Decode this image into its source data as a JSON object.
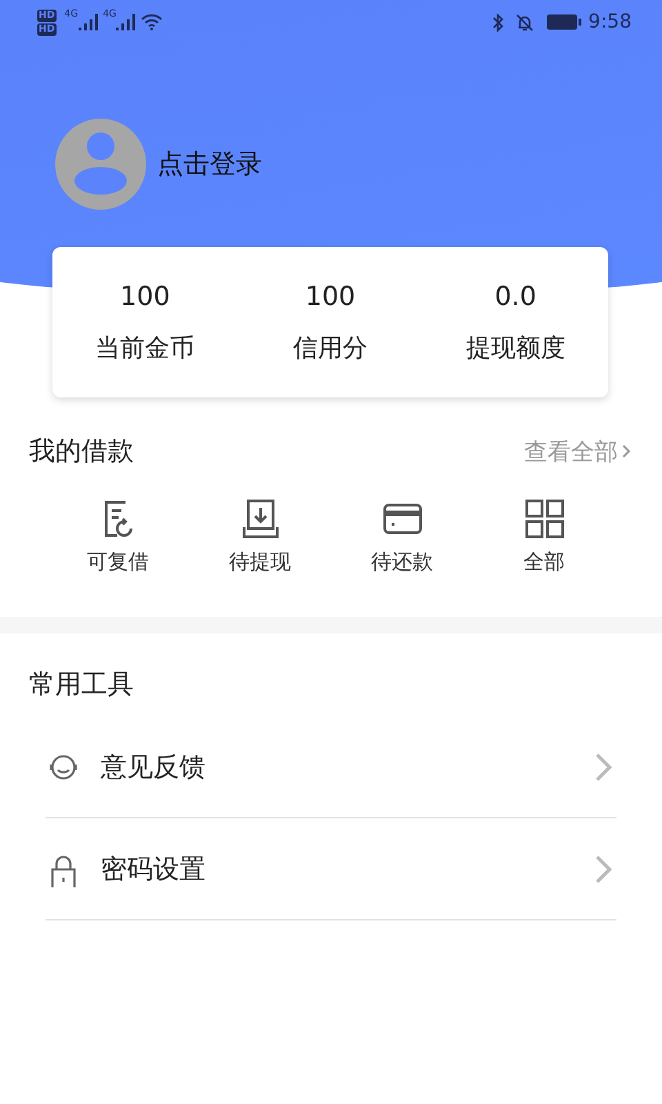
{
  "status_bar": {
    "hd_badges": [
      "HD",
      "HD"
    ],
    "network_labels": [
      "4G",
      "4G"
    ],
    "time": "9:58"
  },
  "profile": {
    "login_label": "点击登录"
  },
  "stats": [
    {
      "value": "100",
      "label": "当前金币"
    },
    {
      "value": "100",
      "label": "信用分"
    },
    {
      "value": "0.0",
      "label": "提现额度"
    }
  ],
  "loans": {
    "title": "我的借款",
    "view_all": "查看全部",
    "items": [
      {
        "kind": "renew",
        "label": "可复借"
      },
      {
        "kind": "withdraw",
        "label": "待提现"
      },
      {
        "kind": "repay",
        "label": "待还款"
      },
      {
        "kind": "all",
        "label": "全部"
      }
    ]
  },
  "tools": {
    "title": "常用工具",
    "items": [
      {
        "kind": "feedback",
        "label": "意见反馈"
      },
      {
        "kind": "password",
        "label": "密码设置"
      }
    ]
  }
}
